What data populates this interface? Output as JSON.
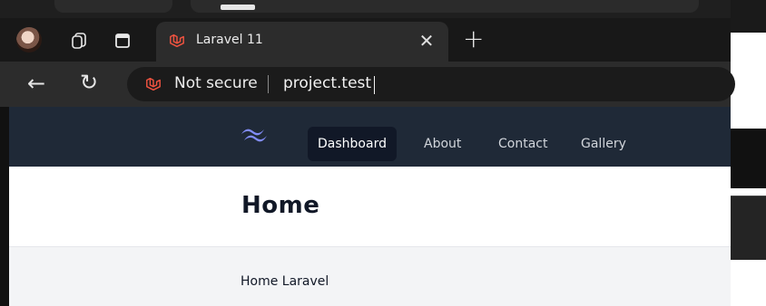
{
  "tab": {
    "title": "Laravel 11"
  },
  "address": {
    "security_label": "Not secure",
    "url": "project.test"
  },
  "nav": {
    "items": [
      {
        "label": "Dashboard",
        "active": true
      },
      {
        "label": "About",
        "active": false
      },
      {
        "label": "Contact",
        "active": false
      },
      {
        "label": "Gallery",
        "active": false
      }
    ]
  },
  "page": {
    "heading": "Home",
    "body": "Home Laravel"
  },
  "icons": {
    "logo": "tailwind-logo-icon",
    "favicon": "laravel-icon",
    "back": "arrow-left-icon",
    "reload": "reload-icon",
    "close": "close-icon",
    "new_tab": "plus-icon",
    "workspaces": "workspaces-icon",
    "tab_actions": "tab-actions-icon"
  },
  "colors": {
    "nav_bg": "#1f2937",
    "nav_active_bg": "#111827",
    "laravel_red": "#f05340",
    "tailwind_blue": "#818cf8"
  }
}
